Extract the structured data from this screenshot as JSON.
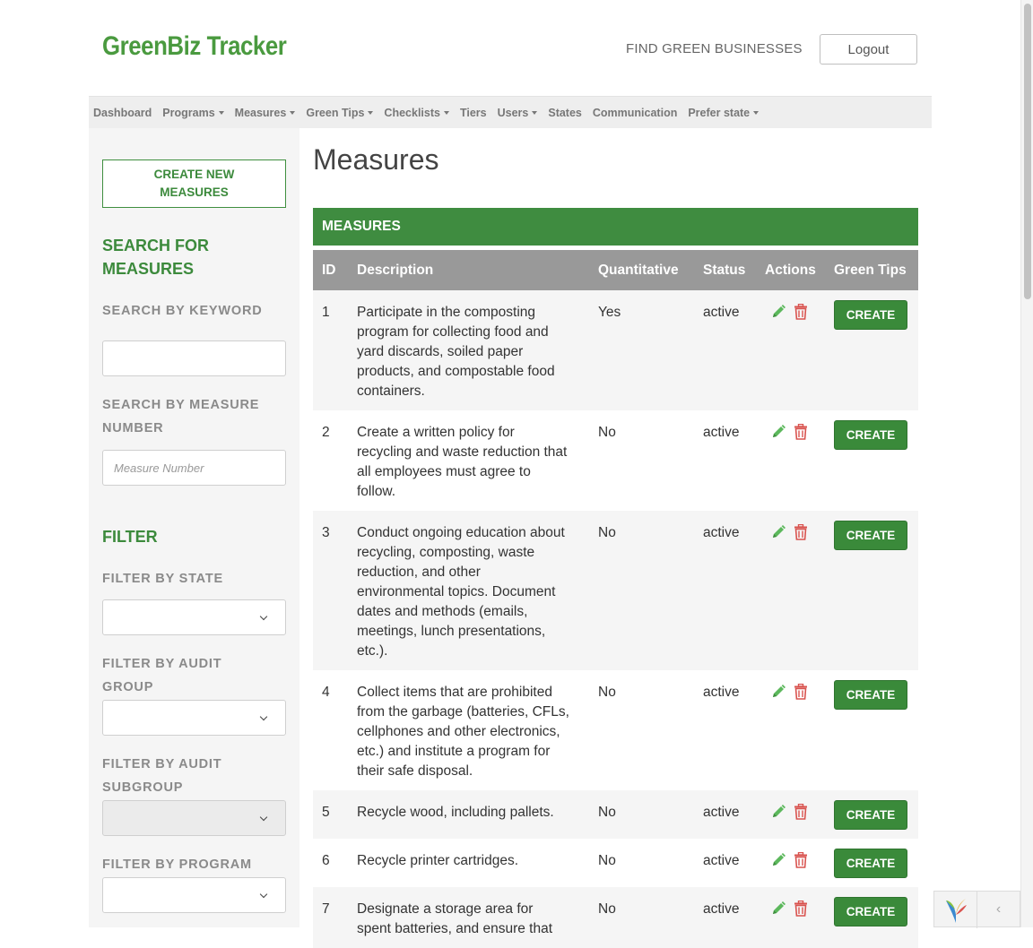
{
  "header": {
    "brand": "GreenBiz Tracker",
    "find_link": "FIND GREEN BUSINESSES",
    "logout": "Logout"
  },
  "nav": {
    "items": [
      {
        "label": "Dashboard",
        "dropdown": false
      },
      {
        "label": "Programs",
        "dropdown": true
      },
      {
        "label": "Measures",
        "dropdown": true
      },
      {
        "label": "Green Tips",
        "dropdown": true
      },
      {
        "label": "Checklists",
        "dropdown": true
      },
      {
        "label": "Tiers",
        "dropdown": false
      },
      {
        "label": "Users",
        "dropdown": true
      },
      {
        "label": "States",
        "dropdown": false
      },
      {
        "label": "Communication",
        "dropdown": false
      },
      {
        "label": "Prefer state",
        "dropdown": true
      }
    ]
  },
  "sidebar": {
    "create_button": "CREATE NEW MEASURES",
    "search_heading": "SEARCH FOR MEASURES",
    "keyword_label": "SEARCH BY KEYWORD",
    "keyword_value": "",
    "number_label": "SEARCH BY MEASURE NUMBER",
    "number_placeholder": "Measure Number",
    "filter_heading": "FILTER",
    "state_label": "FILTER BY STATE",
    "audit_group_label": "FILTER BY AUDIT GROUP",
    "audit_subgroup_label": "FILTER BY AUDIT SUBGROUP",
    "program_label": "FILTER BY PROGRAM"
  },
  "main": {
    "title": "Measures",
    "table_caption": "MEASURES",
    "columns": [
      "ID",
      "Description",
      "Quantitative",
      "Status",
      "Actions",
      "Green Tips"
    ],
    "create_label": "CREATE",
    "rows": [
      {
        "id": "1",
        "description": "Participate in the composting program for collecting food and yard discards, soiled paper products, and compostable food containers.",
        "quantitative": "Yes",
        "status": "active"
      },
      {
        "id": "2",
        "description": "Create a written policy for recycling and waste reduction that all employees must agree to follow.",
        "quantitative": "No",
        "status": "active"
      },
      {
        "id": "3",
        "description": "Conduct ongoing education about recycling, composting, waste reduction, and other environmental topics. Document dates and methods (emails, meetings, lunch presentations, etc.).",
        "quantitative": "No",
        "status": "active"
      },
      {
        "id": "4",
        "description": "Collect items that are prohibited from the garbage (batteries, CFLs, cellphones and other electronics, etc.) and institute a program for their safe disposal.",
        "quantitative": "No",
        "status": "active"
      },
      {
        "id": "5",
        "description": "Recycle wood, including pallets.",
        "quantitative": "No",
        "status": "active"
      },
      {
        "id": "6",
        "description": "Recycle printer cartridges.",
        "quantitative": "No",
        "status": "active"
      },
      {
        "id": "7",
        "description": "Designate a storage area for spent batteries, and ensure that",
        "quantitative": "No",
        "status": "active"
      }
    ]
  },
  "colors": {
    "brand_green": "#4a9a3f",
    "caption_green": "#3f8c40",
    "button_green": "#3a8a3a",
    "header_gray": "#999999",
    "edit_icon": "#5cb85c",
    "delete_icon": "#d9534f"
  },
  "icons": {
    "edit": "pencil-icon",
    "delete": "trash-icon",
    "caret": "caret-down-icon",
    "select": "chevron-down-icon",
    "widget_logo": "yii-logo-icon",
    "widget_collapse": "chevron-left-icon"
  }
}
